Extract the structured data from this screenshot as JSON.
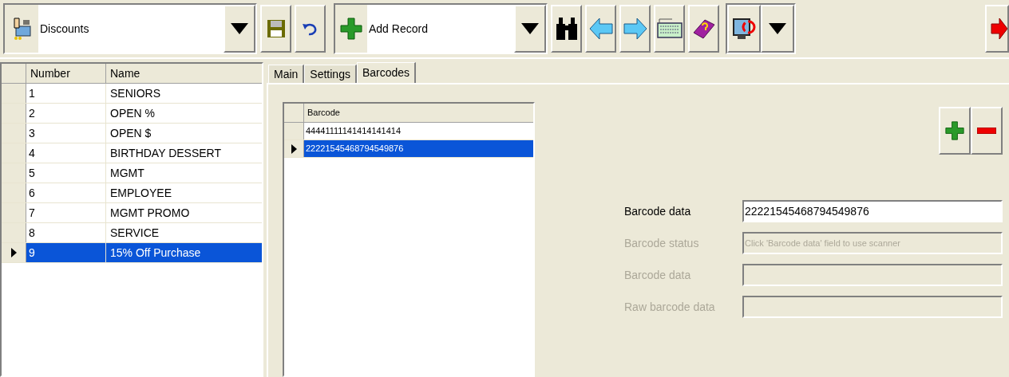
{
  "module_selector": {
    "value": "Discounts"
  },
  "action_selector": {
    "value": "Add Record"
  },
  "records": {
    "columns": [
      "Number",
      "Name"
    ],
    "rows": [
      {
        "number": "1",
        "name": "SENIORS",
        "selected": false
      },
      {
        "number": "2",
        "name": "OPEN %",
        "selected": false
      },
      {
        "number": "3",
        "name": "OPEN $",
        "selected": false
      },
      {
        "number": "4",
        "name": "BIRTHDAY DESSERT",
        "selected": false
      },
      {
        "number": "5",
        "name": "MGMT",
        "selected": false
      },
      {
        "number": "6",
        "name": "EMPLOYEE",
        "selected": false
      },
      {
        "number": "7",
        "name": "MGMT PROMO",
        "selected": false
      },
      {
        "number": "8",
        "name": "SERVICE",
        "selected": false
      },
      {
        "number": "9",
        "name": "15% Off Purchase",
        "selected": true
      }
    ]
  },
  "tabs": [
    {
      "label": "Main",
      "selected": false
    },
    {
      "label": "Settings",
      "selected": false
    },
    {
      "label": "Barcodes",
      "selected": true
    }
  ],
  "barcodes": {
    "columns": [
      "Barcode"
    ],
    "rows": [
      {
        "value": "44441111141414141414",
        "selected": false
      },
      {
        "value": "22221545468794549876",
        "selected": true
      }
    ]
  },
  "form": {
    "fields": [
      {
        "label": "Barcode data",
        "value": "22221545468794549876",
        "disabled": false
      },
      {
        "label": "Barcode status",
        "value": "Click 'Barcode data' field to use scanner",
        "disabled": true
      },
      {
        "label": "Barcode data",
        "disabled": true
      },
      {
        "label": "Raw barcode data",
        "disabled": true
      }
    ]
  }
}
